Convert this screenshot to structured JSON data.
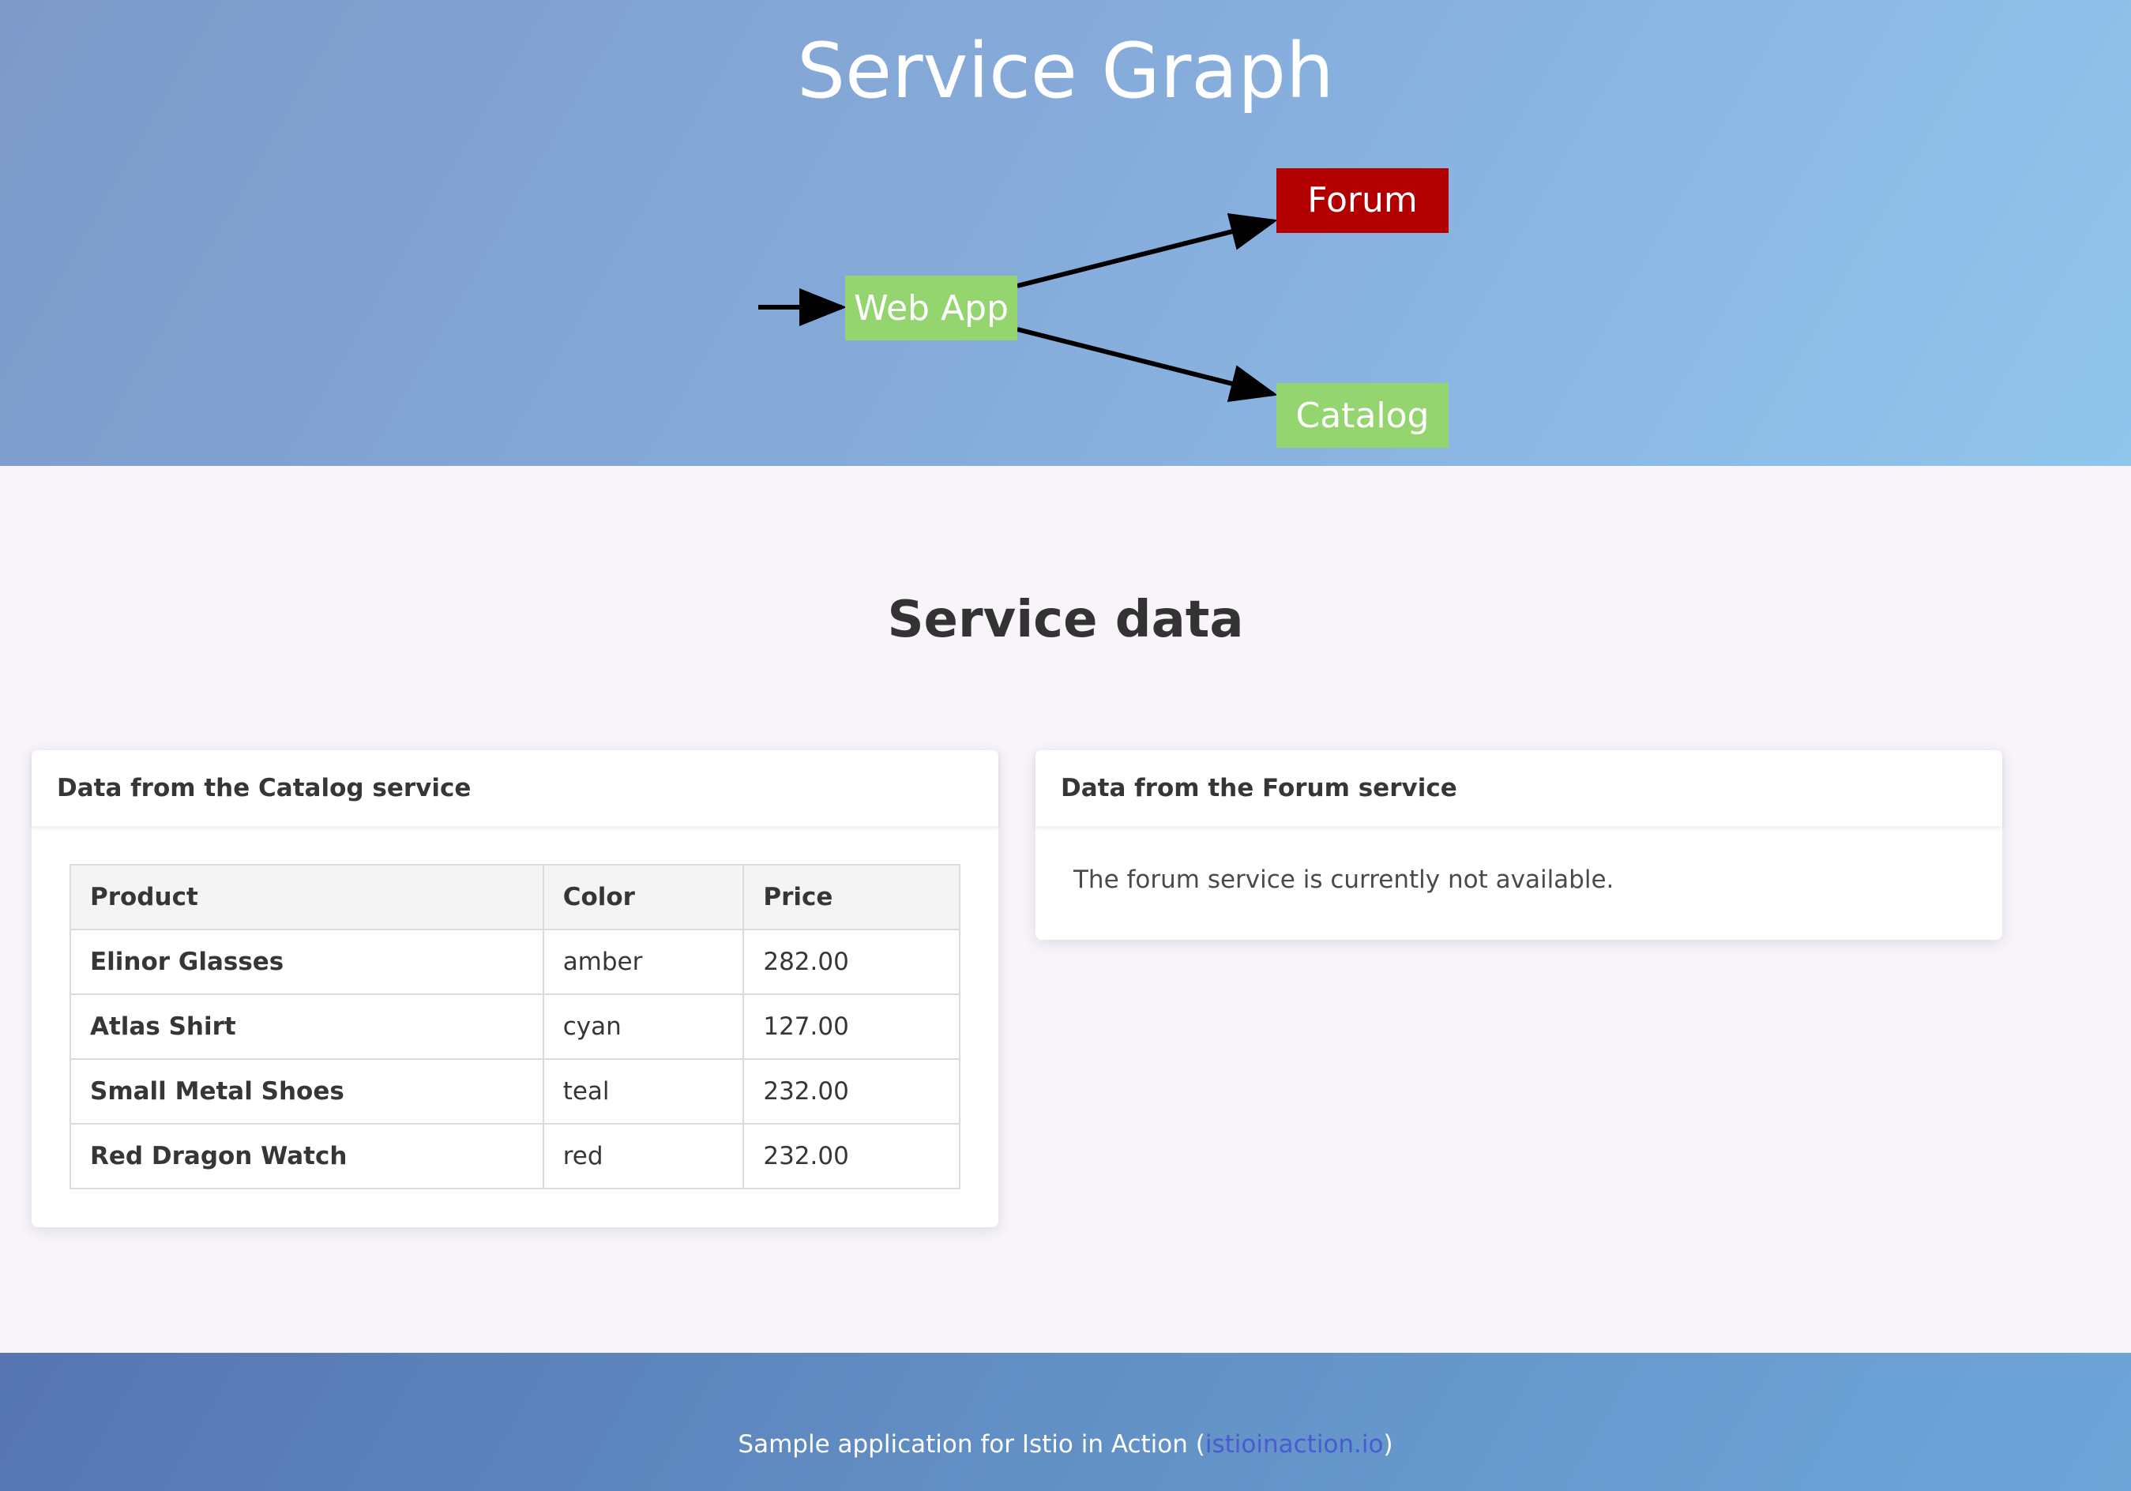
{
  "header": {
    "title": "Service Graph"
  },
  "graph": {
    "nodes": {
      "webapp": {
        "label": "Web App",
        "color": "#94d56f"
      },
      "forum": {
        "label": "Forum",
        "color": "#b20000"
      },
      "catalog": {
        "label": "Catalog",
        "color": "#94d56f"
      }
    },
    "edges": [
      {
        "from": "entry",
        "to": "webapp"
      },
      {
        "from": "webapp",
        "to": "forum"
      },
      {
        "from": "webapp",
        "to": "catalog"
      }
    ]
  },
  "main": {
    "title": "Service data",
    "catalog_card": {
      "title": "Data from the Catalog service",
      "columns": [
        "Product",
        "Color",
        "Price"
      ],
      "rows": [
        {
          "product": "Elinor Glasses",
          "color": "amber",
          "price": "282.00"
        },
        {
          "product": "Atlas Shirt",
          "color": "cyan",
          "price": "127.00"
        },
        {
          "product": "Small Metal Shoes",
          "color": "teal",
          "price": "232.00"
        },
        {
          "product": "Red Dragon Watch",
          "color": "red",
          "price": "232.00"
        }
      ]
    },
    "forum_card": {
      "title": "Data from the Forum service",
      "message": "The forum service is currently not available."
    }
  },
  "footer": {
    "text_before": "Sample application for Istio in Action (",
    "link_text": "istioinaction.io",
    "text_after": ")"
  },
  "colors": {
    "header_gradient_start": "#7d9ac9",
    "header_gradient_end": "#91c5ec",
    "page_background": "#f8f4fa",
    "footer_gradient_start": "#5675b2",
    "footer_gradient_end": "#6ea6d9",
    "link": "#4a5bd0",
    "healthy_node": "#94d56f",
    "failed_node": "#b20000"
  }
}
